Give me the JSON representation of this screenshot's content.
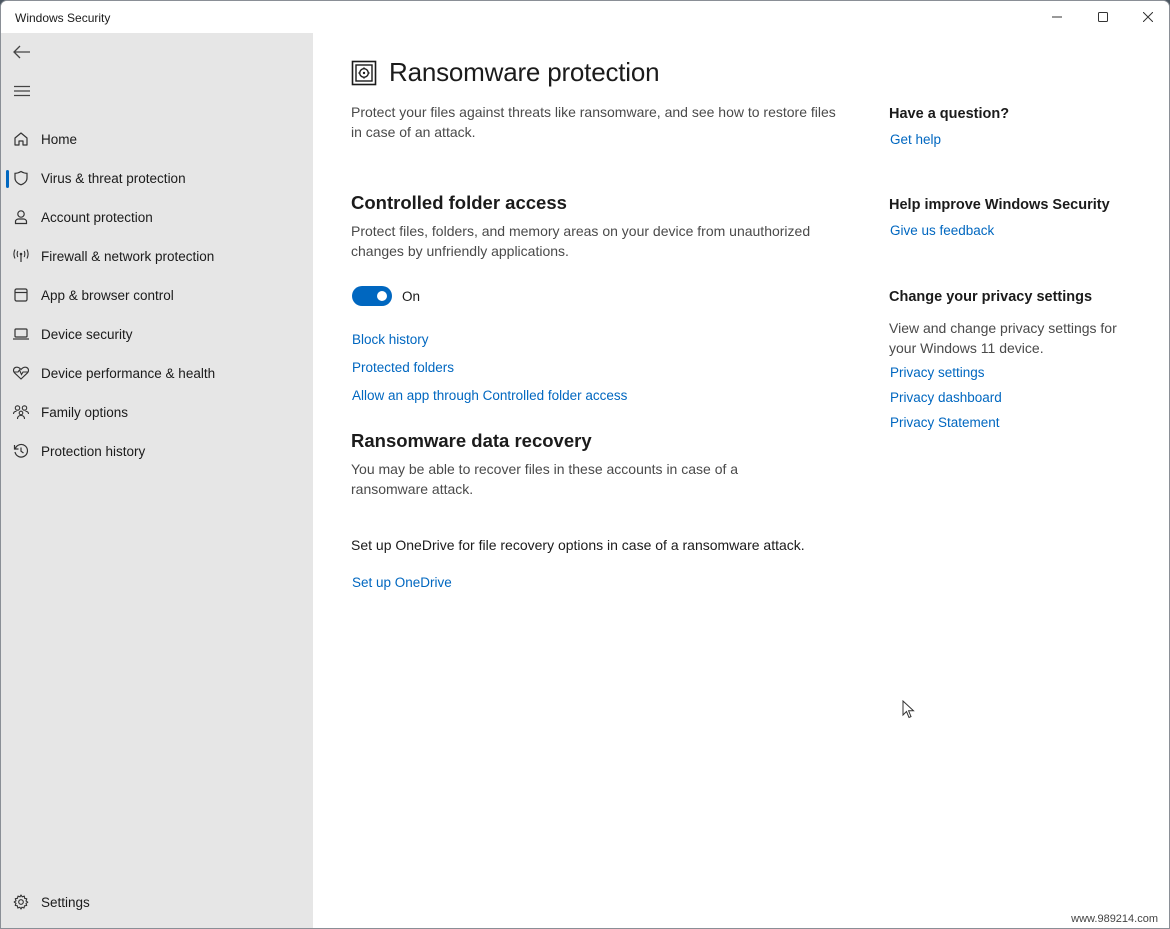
{
  "window": {
    "title": "Windows Security",
    "controls": {
      "minimize": "minimize",
      "maximize": "maximize",
      "close": "close"
    }
  },
  "sidebar": {
    "back_icon": "back-arrow-icon",
    "menu_icon": "hamburger-menu-icon",
    "items": [
      {
        "label": "Home",
        "icon": "home-icon",
        "active": false
      },
      {
        "label": "Virus & threat protection",
        "icon": "shield-icon",
        "active": true
      },
      {
        "label": "Account protection",
        "icon": "person-icon",
        "active": false
      },
      {
        "label": "Firewall & network protection",
        "icon": "antenna-icon",
        "active": false
      },
      {
        "label": "App & browser control",
        "icon": "app-window-icon",
        "active": false
      },
      {
        "label": "Device security",
        "icon": "laptop-icon",
        "active": false
      },
      {
        "label": "Device performance & health",
        "icon": "heart-pulse-icon",
        "active": false
      },
      {
        "label": "Family options",
        "icon": "family-icon",
        "active": false
      },
      {
        "label": "Protection history",
        "icon": "history-icon",
        "active": false
      }
    ],
    "settings": {
      "label": "Settings",
      "icon": "gear-icon"
    }
  },
  "main": {
    "title": "Ransomware protection",
    "title_icon": "vault-icon",
    "intro": "Protect your files against threats like ransomware, and see how to restore files in case of an attack.",
    "cfa": {
      "heading": "Controlled folder access",
      "description": "Protect files, folders, and memory areas on your device from unauthorized changes by unfriendly applications.",
      "toggle_state": "on",
      "toggle_label": "On",
      "links": [
        "Block history",
        "Protected folders",
        "Allow an app through Controlled folder access"
      ]
    },
    "recovery": {
      "heading": "Ransomware data recovery",
      "description": "You may be able to recover files in these accounts in case of a ransomware attack.",
      "onedrive_text": "Set up OneDrive for file recovery options in case of a ransomware attack.",
      "onedrive_link": "Set up OneDrive"
    }
  },
  "aside": {
    "question": {
      "heading": "Have a question?",
      "link": "Get help"
    },
    "improve": {
      "heading": "Help improve Windows Security",
      "link": "Give us feedback"
    },
    "privacy": {
      "heading": "Change your privacy settings",
      "description": "View and change privacy settings for your Windows 11 device.",
      "links": [
        "Privacy settings",
        "Privacy dashboard",
        "Privacy Statement"
      ]
    }
  },
  "watermark": "www.989214.com",
  "colors": {
    "accent": "#0067c0",
    "sidebar_bg": "#e6e6e6"
  }
}
